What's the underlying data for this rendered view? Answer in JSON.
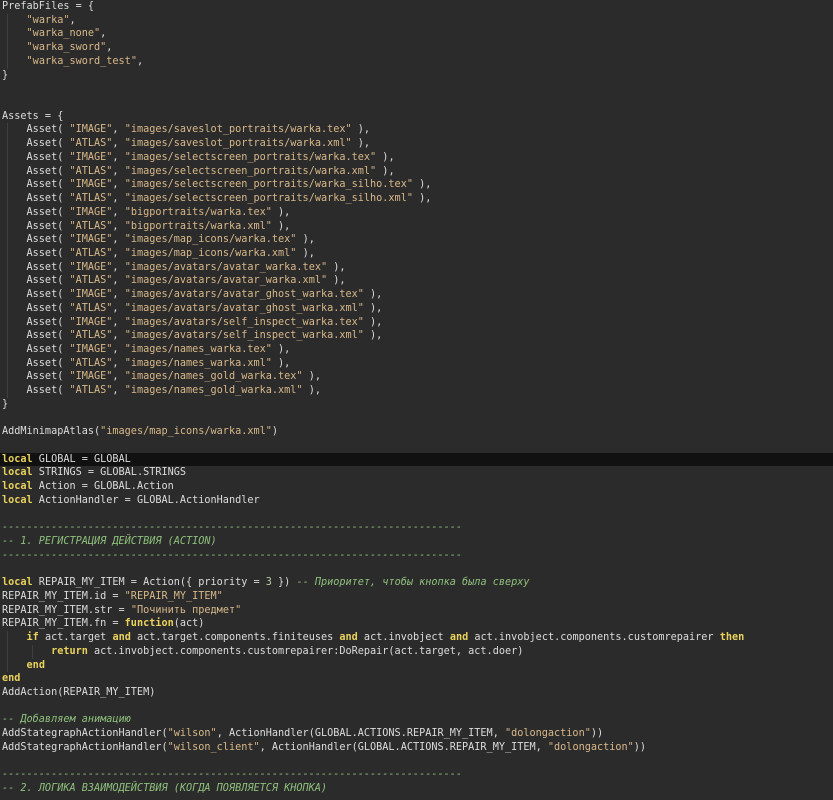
{
  "editor": {
    "language": "lua",
    "current_line_index": 33,
    "colors": {
      "background": "#2b2b2b",
      "current_line": "#111111",
      "text": "#dcdcdc",
      "string": "#d8b88a",
      "keyword": "#e8d25c",
      "number": "#b5cea8",
      "comment": "#8ec07c",
      "indent_guide": "#3f3f3f"
    },
    "lines": [
      [
        {
          "t": "i",
          "v": "PrefabFiles = {"
        }
      ],
      [
        {
          "t": "i",
          "v": "    "
        },
        {
          "t": "s",
          "v": "\"warka\""
        },
        {
          "t": "i",
          "v": ","
        }
      ],
      [
        {
          "t": "i",
          "v": "    "
        },
        {
          "t": "s",
          "v": "\"warka_none\""
        },
        {
          "t": "i",
          "v": ","
        }
      ],
      [
        {
          "t": "i",
          "v": "    "
        },
        {
          "t": "s",
          "v": "\"warka_sword\""
        },
        {
          "t": "i",
          "v": ","
        }
      ],
      [
        {
          "t": "i",
          "v": "    "
        },
        {
          "t": "s",
          "v": "\"warka_sword_test\""
        },
        {
          "t": "i",
          "v": ","
        }
      ],
      [
        {
          "t": "i",
          "v": "}"
        }
      ],
      [],
      [],
      [
        {
          "t": "i",
          "v": "Assets = {"
        }
      ],
      [
        {
          "t": "i",
          "v": "    Asset( "
        },
        {
          "t": "s",
          "v": "\"IMAGE\""
        },
        {
          "t": "i",
          "v": ", "
        },
        {
          "t": "s",
          "v": "\"images/saveslot_portraits/warka.tex\""
        },
        {
          "t": "i",
          "v": " ),"
        }
      ],
      [
        {
          "t": "i",
          "v": "    Asset( "
        },
        {
          "t": "s",
          "v": "\"ATLAS\""
        },
        {
          "t": "i",
          "v": ", "
        },
        {
          "t": "s",
          "v": "\"images/saveslot_portraits/warka.xml\""
        },
        {
          "t": "i",
          "v": " ),"
        }
      ],
      [
        {
          "t": "i",
          "v": "    Asset( "
        },
        {
          "t": "s",
          "v": "\"IMAGE\""
        },
        {
          "t": "i",
          "v": ", "
        },
        {
          "t": "s",
          "v": "\"images/selectscreen_portraits/warka.tex\""
        },
        {
          "t": "i",
          "v": " ),"
        }
      ],
      [
        {
          "t": "i",
          "v": "    Asset( "
        },
        {
          "t": "s",
          "v": "\"ATLAS\""
        },
        {
          "t": "i",
          "v": ", "
        },
        {
          "t": "s",
          "v": "\"images/selectscreen_portraits/warka.xml\""
        },
        {
          "t": "i",
          "v": " ),"
        }
      ],
      [
        {
          "t": "i",
          "v": "    Asset( "
        },
        {
          "t": "s",
          "v": "\"IMAGE\""
        },
        {
          "t": "i",
          "v": ", "
        },
        {
          "t": "s",
          "v": "\"images/selectscreen_portraits/warka_silho.tex\""
        },
        {
          "t": "i",
          "v": " ),"
        }
      ],
      [
        {
          "t": "i",
          "v": "    Asset( "
        },
        {
          "t": "s",
          "v": "\"ATLAS\""
        },
        {
          "t": "i",
          "v": ", "
        },
        {
          "t": "s",
          "v": "\"images/selectscreen_portraits/warka_silho.xml\""
        },
        {
          "t": "i",
          "v": " ),"
        }
      ],
      [
        {
          "t": "i",
          "v": "    Asset( "
        },
        {
          "t": "s",
          "v": "\"IMAGE\""
        },
        {
          "t": "i",
          "v": ", "
        },
        {
          "t": "s",
          "v": "\"bigportraits/warka.tex\""
        },
        {
          "t": "i",
          "v": " ),"
        }
      ],
      [
        {
          "t": "i",
          "v": "    Asset( "
        },
        {
          "t": "s",
          "v": "\"ATLAS\""
        },
        {
          "t": "i",
          "v": ", "
        },
        {
          "t": "s",
          "v": "\"bigportraits/warka.xml\""
        },
        {
          "t": "i",
          "v": " ),"
        }
      ],
      [
        {
          "t": "i",
          "v": "    Asset( "
        },
        {
          "t": "s",
          "v": "\"IMAGE\""
        },
        {
          "t": "i",
          "v": ", "
        },
        {
          "t": "s",
          "v": "\"images/map_icons/warka.tex\""
        },
        {
          "t": "i",
          "v": " ),"
        }
      ],
      [
        {
          "t": "i",
          "v": "    Asset( "
        },
        {
          "t": "s",
          "v": "\"ATLAS\""
        },
        {
          "t": "i",
          "v": ", "
        },
        {
          "t": "s",
          "v": "\"images/map_icons/warka.xml\""
        },
        {
          "t": "i",
          "v": " ),"
        }
      ],
      [
        {
          "t": "i",
          "v": "    Asset( "
        },
        {
          "t": "s",
          "v": "\"IMAGE\""
        },
        {
          "t": "i",
          "v": ", "
        },
        {
          "t": "s",
          "v": "\"images/avatars/avatar_warka.tex\""
        },
        {
          "t": "i",
          "v": " ),"
        }
      ],
      [
        {
          "t": "i",
          "v": "    Asset( "
        },
        {
          "t": "s",
          "v": "\"ATLAS\""
        },
        {
          "t": "i",
          "v": ", "
        },
        {
          "t": "s",
          "v": "\"images/avatars/avatar_warka.xml\""
        },
        {
          "t": "i",
          "v": " ),"
        }
      ],
      [
        {
          "t": "i",
          "v": "    Asset( "
        },
        {
          "t": "s",
          "v": "\"IMAGE\""
        },
        {
          "t": "i",
          "v": ", "
        },
        {
          "t": "s",
          "v": "\"images/avatars/avatar_ghost_warka.tex\""
        },
        {
          "t": "i",
          "v": " ),"
        }
      ],
      [
        {
          "t": "i",
          "v": "    Asset( "
        },
        {
          "t": "s",
          "v": "\"ATLAS\""
        },
        {
          "t": "i",
          "v": ", "
        },
        {
          "t": "s",
          "v": "\"images/avatars/avatar_ghost_warka.xml\""
        },
        {
          "t": "i",
          "v": " ),"
        }
      ],
      [
        {
          "t": "i",
          "v": "    Asset( "
        },
        {
          "t": "s",
          "v": "\"IMAGE\""
        },
        {
          "t": "i",
          "v": ", "
        },
        {
          "t": "s",
          "v": "\"images/avatars/self_inspect_warka.tex\""
        },
        {
          "t": "i",
          "v": " ),"
        }
      ],
      [
        {
          "t": "i",
          "v": "    Asset( "
        },
        {
          "t": "s",
          "v": "\"ATLAS\""
        },
        {
          "t": "i",
          "v": ", "
        },
        {
          "t": "s",
          "v": "\"images/avatars/self_inspect_warka.xml\""
        },
        {
          "t": "i",
          "v": " ),"
        }
      ],
      [
        {
          "t": "i",
          "v": "    Asset( "
        },
        {
          "t": "s",
          "v": "\"IMAGE\""
        },
        {
          "t": "i",
          "v": ", "
        },
        {
          "t": "s",
          "v": "\"images/names_warka.tex\""
        },
        {
          "t": "i",
          "v": " ),"
        }
      ],
      [
        {
          "t": "i",
          "v": "    Asset( "
        },
        {
          "t": "s",
          "v": "\"ATLAS\""
        },
        {
          "t": "i",
          "v": ", "
        },
        {
          "t": "s",
          "v": "\"images/names_warka.xml\""
        },
        {
          "t": "i",
          "v": " ),"
        }
      ],
      [
        {
          "t": "i",
          "v": "    Asset( "
        },
        {
          "t": "s",
          "v": "\"IMAGE\""
        },
        {
          "t": "i",
          "v": ", "
        },
        {
          "t": "s",
          "v": "\"images/names_gold_warka.tex\""
        },
        {
          "t": "i",
          "v": " ),"
        }
      ],
      [
        {
          "t": "i",
          "v": "    Asset( "
        },
        {
          "t": "s",
          "v": "\"ATLAS\""
        },
        {
          "t": "i",
          "v": ", "
        },
        {
          "t": "s",
          "v": "\"images/names_gold_warka.xml\""
        },
        {
          "t": "i",
          "v": " ),"
        }
      ],
      [
        {
          "t": "i",
          "v": "}"
        }
      ],
      [],
      [
        {
          "t": "i",
          "v": "AddMinimapAtlas("
        },
        {
          "t": "s",
          "v": "\"images/map_icons/warka.xml\""
        },
        {
          "t": "i",
          "v": ")"
        }
      ],
      [],
      [
        {
          "t": "k",
          "v": "local"
        },
        {
          "t": "i",
          "v": " GLOBAL = GLOBAL"
        }
      ],
      [
        {
          "t": "k",
          "v": "local"
        },
        {
          "t": "i",
          "v": " STRINGS = GLOBAL.STRINGS"
        }
      ],
      [
        {
          "t": "k",
          "v": "local"
        },
        {
          "t": "i",
          "v": " Action = GLOBAL.Action"
        }
      ],
      [
        {
          "t": "k",
          "v": "local"
        },
        {
          "t": "i",
          "v": " ActionHandler = GLOBAL.ActionHandler"
        }
      ],
      [],
      [
        {
          "t": "c",
          "v": "---------------------------------------------------------------------------"
        }
      ],
      [
        {
          "t": "c",
          "v": "-- 1. РЕГИСТРАЦИЯ ДЕЙСТВИЯ (ACTION)"
        }
      ],
      [
        {
          "t": "c",
          "v": "---------------------------------------------------------------------------"
        }
      ],
      [],
      [
        {
          "t": "k",
          "v": "local"
        },
        {
          "t": "i",
          "v": " REPAIR_MY_ITEM = Action({ priority = "
        },
        {
          "t": "n",
          "v": "3"
        },
        {
          "t": "i",
          "v": " }) "
        },
        {
          "t": "c",
          "v": "-- Приоритет, чтобы кнопка была сверху"
        }
      ],
      [
        {
          "t": "i",
          "v": "REPAIR_MY_ITEM.id = "
        },
        {
          "t": "s",
          "v": "\"REPAIR_MY_ITEM\""
        }
      ],
      [
        {
          "t": "i",
          "v": "REPAIR_MY_ITEM.str = "
        },
        {
          "t": "s",
          "v": "\"Починить предмет\""
        }
      ],
      [
        {
          "t": "i",
          "v": "REPAIR_MY_ITEM.fn = "
        },
        {
          "t": "k",
          "v": "function"
        },
        {
          "t": "i",
          "v": "(act)"
        }
      ],
      [
        {
          "t": "i",
          "v": "    "
        },
        {
          "t": "k",
          "v": "if"
        },
        {
          "t": "i",
          "v": " act.target "
        },
        {
          "t": "k",
          "v": "and"
        },
        {
          "t": "i",
          "v": " act.target.components.finiteuses "
        },
        {
          "t": "k",
          "v": "and"
        },
        {
          "t": "i",
          "v": " act.invobject "
        },
        {
          "t": "k",
          "v": "and"
        },
        {
          "t": "i",
          "v": " act.invobject.components.customrepairer "
        },
        {
          "t": "k",
          "v": "then"
        }
      ],
      [
        {
          "t": "i",
          "v": "        "
        },
        {
          "t": "k",
          "v": "return"
        },
        {
          "t": "i",
          "v": " act.invobject.components.customrepairer:DoRepair(act.target, act.doer)"
        }
      ],
      [
        {
          "t": "i",
          "v": "    "
        },
        {
          "t": "k",
          "v": "end"
        }
      ],
      [
        {
          "t": "k",
          "v": "end"
        }
      ],
      [
        {
          "t": "i",
          "v": "AddAction(REPAIR_MY_ITEM)"
        }
      ],
      [],
      [
        {
          "t": "c",
          "v": "-- Добавляем анимацию"
        }
      ],
      [
        {
          "t": "i",
          "v": "AddStategraphActionHandler("
        },
        {
          "t": "s",
          "v": "\"wilson\""
        },
        {
          "t": "i",
          "v": ", ActionHandler(GLOBAL.ACTIONS.REPAIR_MY_ITEM, "
        },
        {
          "t": "s",
          "v": "\"dolongaction\""
        },
        {
          "t": "i",
          "v": "))"
        }
      ],
      [
        {
          "t": "i",
          "v": "AddStategraphActionHandler("
        },
        {
          "t": "s",
          "v": "\"wilson_client\""
        },
        {
          "t": "i",
          "v": ", ActionHandler(GLOBAL.ACTIONS.REPAIR_MY_ITEM, "
        },
        {
          "t": "s",
          "v": "\"dolongaction\""
        },
        {
          "t": "i",
          "v": "))"
        }
      ],
      [],
      [
        {
          "t": "c",
          "v": "---------------------------------------------------------------------------"
        }
      ],
      [
        {
          "t": "c",
          "v": "-- 2. ЛОГИКА ВЗАИМОДЕЙСТВИЯ (КОГДА ПОЯВЛЯЕТСЯ КНОПКА)"
        }
      ],
      [
        {
          "t": "c",
          "v": "---------------------------------------------------------------------------"
        }
      ]
    ]
  }
}
